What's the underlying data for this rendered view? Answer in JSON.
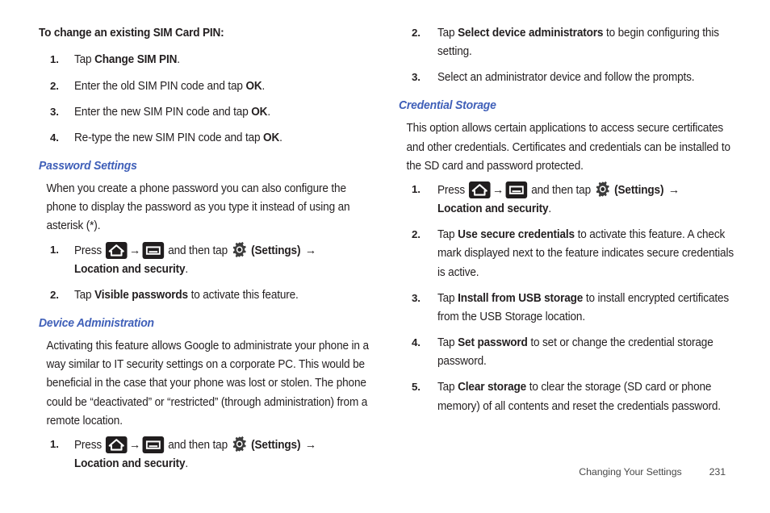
{
  "document": {
    "footer": {
      "chapter_title": "Changing Your Settings",
      "page_number": "231"
    },
    "theme": {
      "heading_color": "#3f5fb8",
      "text_color": "#231f20",
      "background": "#ffffff"
    }
  },
  "icons": {
    "home": "home-key-icon",
    "menu": "menu-key-icon",
    "gear": "settings-gear-icon",
    "arrow": "→"
  },
  "left_column": {
    "lead": "To change an existing SIM Card PIN:",
    "sim_steps": [
      {
        "num": "1.",
        "pre": "Tap ",
        "bold": "Change SIM PIN",
        "post": "."
      },
      {
        "num": "2.",
        "pre": "Enter the old SIM PIN code and tap ",
        "bold": "OK",
        "post": "."
      },
      {
        "num": "3.",
        "pre": "Enter the new SIM PIN code and tap ",
        "bold": "OK",
        "post": "."
      },
      {
        "num": "4.",
        "pre": "Re-type the new SIM PIN code and tap ",
        "bold": "OK",
        "post": "."
      }
    ],
    "password_settings": {
      "heading": "Password Settings",
      "para": "When you create a phone password you can also configure the phone to display the password as you type it instead of using an asterisk (*).",
      "step1": {
        "num": "1.",
        "press_label": "Press ",
        "and_then_tap": " and then tap ",
        "settings_label": "(Settings)",
        "destination": "Location and security",
        "period": "."
      },
      "step2": {
        "num": "2.",
        "pre": "Tap ",
        "bold": "Visible passwords",
        "post": " to activate this feature."
      }
    },
    "device_administration": {
      "heading": "Device Administration",
      "para": "Activating this feature allows Google to administrate your phone in a way similar to IT security settings on a corporate PC. This would be beneficial in the case that your phone was lost or stolen. The phone could be “deactivated” or “restricted” (through administration) from a remote location.",
      "step1": {
        "num": "1.",
        "press_label": "Press ",
        "and_then_tap": " and then tap ",
        "settings_label": "(Settings)",
        "destination": "Location and security",
        "period": "."
      }
    }
  },
  "right_column": {
    "device_admin_steps": [
      {
        "num": "2.",
        "pre": "Tap ",
        "bold": "Select device administrators",
        "post": " to begin configuring this setting."
      },
      {
        "num": "3.",
        "pre": "Select an administrator device and follow the prompts.",
        "bold": "",
        "post": ""
      }
    ],
    "credential_storage": {
      "heading": "Credential Storage",
      "para": "This option allows certain applications to access secure certificates and other credentials. Certificates and credentials can be installed to the SD card and password protected.",
      "step1": {
        "num": "1.",
        "press_label": "Press ",
        "and_then_tap": " and then tap ",
        "settings_label": "(Settings)",
        "destination": "Location and security",
        "period": "."
      },
      "steps": [
        {
          "num": "2.",
          "pre": "Tap ",
          "bold": "Use secure credentials",
          "post": " to activate this feature. A check mark displayed next to the feature indicates secure credentials is active."
        },
        {
          "num": "3.",
          "pre": "Tap ",
          "bold": "Install from USB storage",
          "post": " to install encrypted certificates from the USB Storage location."
        },
        {
          "num": "4.",
          "pre": "Tap ",
          "bold": "Set password",
          "post": " to set or change the credential storage password."
        },
        {
          "num": "5.",
          "pre": "Tap ",
          "bold": "Clear storage",
          "post": " to clear the storage (SD card or phone memory) of all contents and reset the credentials password."
        }
      ]
    }
  }
}
